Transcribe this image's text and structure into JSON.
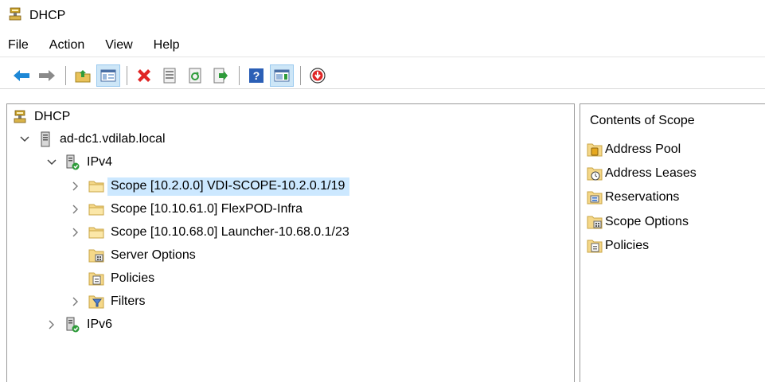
{
  "window": {
    "title": "DHCP"
  },
  "menu": [
    "File",
    "Action",
    "View",
    "Help"
  ],
  "toolbar": {
    "buttons": [
      "back-arrow-icon",
      "forward-arrow-icon",
      "up-folder-icon",
      "show-hide-tree-icon",
      "delete-icon",
      "properties-icon",
      "refresh-icon",
      "export-icon",
      "help-icon",
      "show-hide-action-pane-icon",
      "deactivate-icon"
    ]
  },
  "tree": {
    "root": "DHCP",
    "server": "ad-dc1.vdilab.local",
    "ipv4": "IPv4",
    "scopes": [
      "Scope [10.2.0.0] VDI-SCOPE-10.2.0.1/19",
      "Scope [10.10.61.0] FlexPOD-Infra",
      "Scope [10.10.68.0] Launcher-10.68.0.1/23"
    ],
    "server_options": "Server Options",
    "policies": "Policies",
    "filters": "Filters",
    "ipv6": "IPv6"
  },
  "contents": {
    "title": "Contents of Scope",
    "items": [
      "Address Pool",
      "Address Leases",
      "Reservations",
      "Scope Options",
      "Policies"
    ]
  },
  "colors": {
    "selection": "#cce8ff",
    "folder": "#f5d889"
  }
}
